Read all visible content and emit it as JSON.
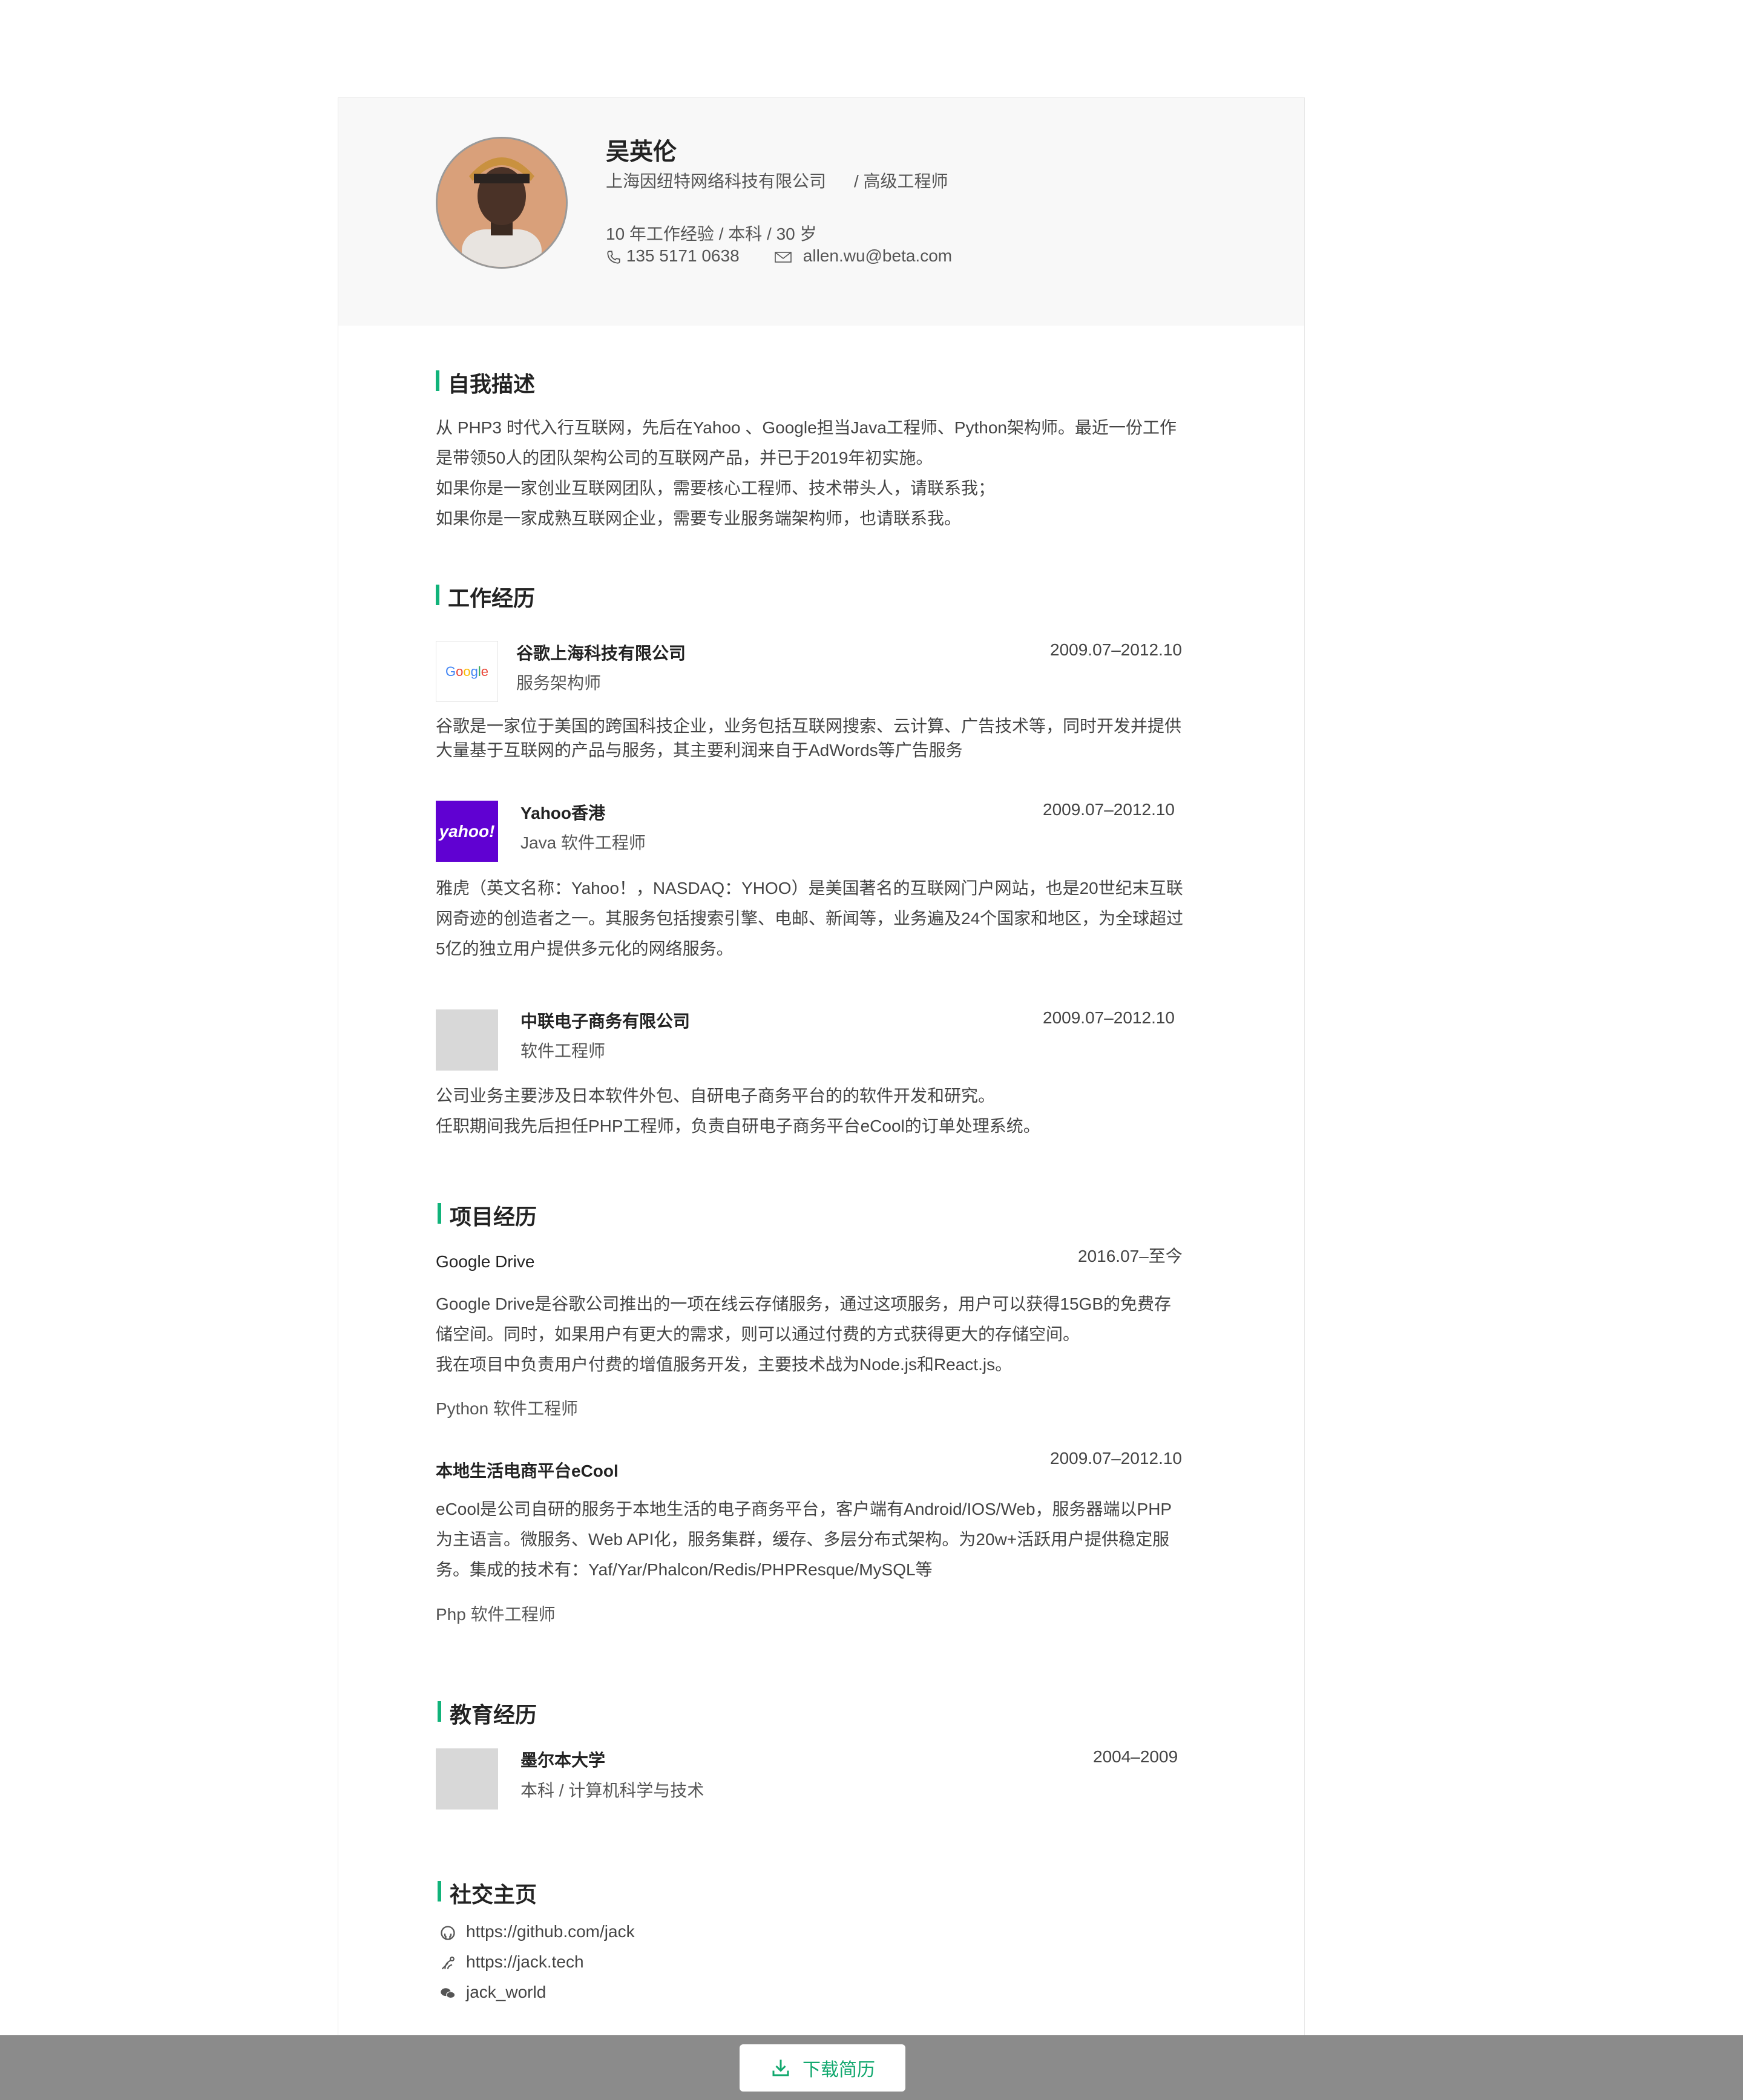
{
  "profile": {
    "name": "吴英伦",
    "company": "上海因纽特网络科技有限公司",
    "title": "/ 高级工程师",
    "summary": "10 年工作经验 / 本科 / 30 岁",
    "phone": "135 5171 0638",
    "email": "allen.wu@beta.com"
  },
  "self_intro": {
    "heading": "自我描述",
    "lines": [
      "从 PHP3 时代入行互联网，先后在Yahoo 、Google担当Java工程师、Python架构师。最近一份工作是带领50人的团队架构公司的互联网产品，并已于2019年初实施。",
      "如果你是一家创业互联网团队，需要核心工程师、技术带头人，请联系我；",
      "如果你是一家成熟互联网企业，需要专业服务端架构师，也请联系我。"
    ]
  },
  "work": {
    "heading": "工作经历",
    "items": [
      {
        "company": "谷歌上海科技有限公司",
        "role": "服务架构师",
        "date": "2009.07–2012.10",
        "logo": "Google",
        "desc": "谷歌是一家位于美国的跨国科技企业，业务包括互联网搜索、云计算、广告技术等，同时开发并提供大量基于互联网的产品与服务，其主要利润来自于AdWords等广告服务"
      },
      {
        "company": "Yahoo香港",
        "role": "Java 软件工程师",
        "date": "2009.07–2012.10",
        "logo": "yahoo!",
        "desc": "雅虎（英文名称：Yahoo！，NASDAQ：YHOO）是美国著名的互联网门户网站，也是20世纪末互联网奇迹的创造者之一。其服务包括搜索引擎、电邮、新闻等，业务遍及24个国家和地区，为全球超过5亿的独立用户提供多元化的网络服务。"
      },
      {
        "company": "中联电子商务有限公司",
        "role": "软件工程师",
        "date": "2009.07–2012.10",
        "logo": "",
        "desc_lines": [
          "公司业务主要涉及日本软件外包、自研电子商务平台的的软件开发和研究。",
          "任职期间我先后担任PHP工程师，负责自研电子商务平台eCool的订单处理系统。"
        ]
      }
    ]
  },
  "projects": {
    "heading": "项目经历",
    "items": [
      {
        "name": "Google Drive",
        "date": "2016.07–至今",
        "desc": "Google Drive是谷歌公司推出的一项在线云存储服务，通过这项服务，用户可以获得15GB的免费存储空间。同时，如果用户有更大的需求，则可以通过付费的方式获得更大的存储空间。",
        "desc2": "我在项目中负责用户付费的增值服务开发，主要技术战为Node.js和React.js。",
        "role": "Python 软件工程师"
      },
      {
        "name": "本地生活电商平台eCool",
        "date": "2009.07–2012.10",
        "desc": "eCool是公司自研的服务于本地生活的电子商务平台，客户端有Android/IOS/Web，服务器端以PHP为主语言。微服务、Web API化，服务集群，缓存、多层分布式架构。为20w+活跃用户提供稳定服务。集成的技术有：Yaf/Yar/Phalcon/Redis/PHPResque/MySQL等",
        "role": "Php 软件工程师"
      }
    ]
  },
  "education": {
    "heading": "教育经历",
    "items": [
      {
        "school": "墨尔本大学",
        "degree": "本科 / 计算机科学与技术",
        "date": "2004–2009"
      }
    ]
  },
  "social": {
    "heading": "社交主页",
    "github": "https://github.com/jack",
    "blog": "https://jack.tech",
    "wechat": "jack_world"
  },
  "download_label": "下载简历",
  "colors": {
    "accent": "#11b37a",
    "header_bg": "#f8f8f8",
    "bottom_bar": "#8b8b8b"
  }
}
